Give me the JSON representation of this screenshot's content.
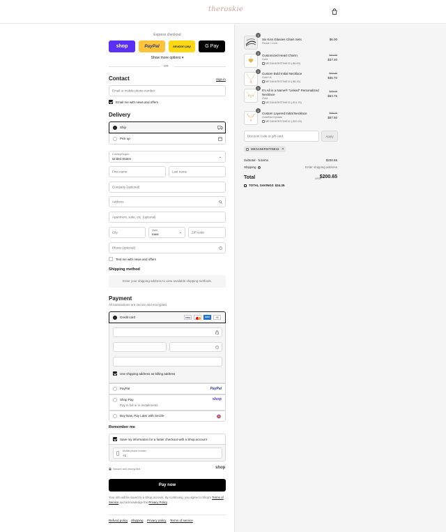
{
  "header": {
    "logo_text": "theroskie"
  },
  "express": {
    "label": "Express checkout",
    "buttons": [
      "shop",
      "PayPal",
      "amazon pay",
      "G Pay"
    ],
    "show_more": "Show more options",
    "or": "OR"
  },
  "contact": {
    "title": "Contact",
    "sign_in": "Sign in",
    "email_placeholder": "Email or mobile phone number",
    "email_news": "Email me with news and offers"
  },
  "delivery": {
    "title": "Delivery",
    "ship": "Ship",
    "pickup": "Pick up",
    "country_label": "Country/Region",
    "country_value": "United States",
    "first_name": "First name",
    "last_name": "Last name",
    "company": "Company (optional)",
    "address": "Address",
    "apartment": "Apartment, suite, etc. (optional)",
    "city": "City",
    "state_label": "State",
    "state_value": "Iowa",
    "zip": "ZIP code",
    "phone": "Phone (optional)",
    "text_news": "Text me with news and offers"
  },
  "shipping_method": {
    "title": "Shipping method",
    "notice": "Enter your shipping address to view available shipping methods."
  },
  "payment": {
    "title": "Payment",
    "subtitle": "All transactions are secure and encrypted.",
    "credit_card": "Credit card",
    "card_badges": [
      "VISA",
      "MC",
      "AMEX",
      "+5"
    ],
    "billing_same": "Use shipping address as billing address",
    "paypal": "PayPal",
    "paypal_logo": "PayPal",
    "shop_pay": "Shop Pay",
    "shop_pay_sub": "Pay in full or in installments",
    "shop_logo": "shop",
    "sezzle": "Buy Now, Pay Later with Sezzle"
  },
  "remember": {
    "title": "Remember me",
    "save_info": "Save my information for a faster checkout with a Shop account",
    "mobile_label": "Mobile phone number",
    "mobile_value": "+1",
    "secure": "Secure and encrypted",
    "shop_logo": "shop"
  },
  "pay_now": "Pay now",
  "legal": {
    "text1": "Your info will be saved to a Shop account. By continuing, you agree to Shop's",
    "terms": "Terms of Service",
    "text2": "and acknowledge the",
    "privacy": "Privacy Policy",
    "text3": "."
  },
  "footer_links": [
    "Refund policy",
    "Shipping",
    "Privacy policy",
    "Terms of service"
  ],
  "cart": {
    "items": [
      {
        "qty": "1",
        "name": "Six Kiss Glasses Chain Sets",
        "variant": "Peace / Love",
        "discount": "",
        "original": "",
        "price": "$6.00"
      },
      {
        "qty": "1",
        "name": "Customized Heart Charm",
        "variant": "Gold",
        "discount": "MEGANKRISTINE15 (-$6.60)",
        "original": "$44.00",
        "price": "$37.40"
      },
      {
        "qty": "1",
        "name": "Custom Bold Initial Necklace",
        "variant": "Gold / A",
        "discount": "MEGANKRISTINE15 (-$6.30)",
        "original": "$42.00",
        "price": "$35.70"
      },
      {
        "qty": "1",
        "name": "It's All in a Name® \"Linked\" Personalized Necklace",
        "variant": "Gold",
        "discount": "MEGANKRISTINE15 (-$11.25)",
        "original": "$75.00",
        "price": "$63.75"
      },
      {
        "qty": "1",
        "name": "Custom Layered Initial Necklace",
        "variant": "Gold/No Crystals",
        "discount": "MEGANKRISTINE15 (-$10.20)",
        "original": "$68.00",
        "price": "$57.80"
      }
    ],
    "discount_placeholder": "Discount code or gift card",
    "apply": "Apply",
    "applied_code": "MEGANKRISTINE15",
    "subtotal_label": "Subtotal · 5 items",
    "subtotal_value": "$200.65",
    "shipping_label": "Shipping",
    "shipping_value": "Enter shipping address",
    "total_label": "Total",
    "currency": "USD",
    "total_value": "$200.65",
    "savings_label": "TOTAL SAVINGS",
    "savings_value": "$34.35"
  }
}
